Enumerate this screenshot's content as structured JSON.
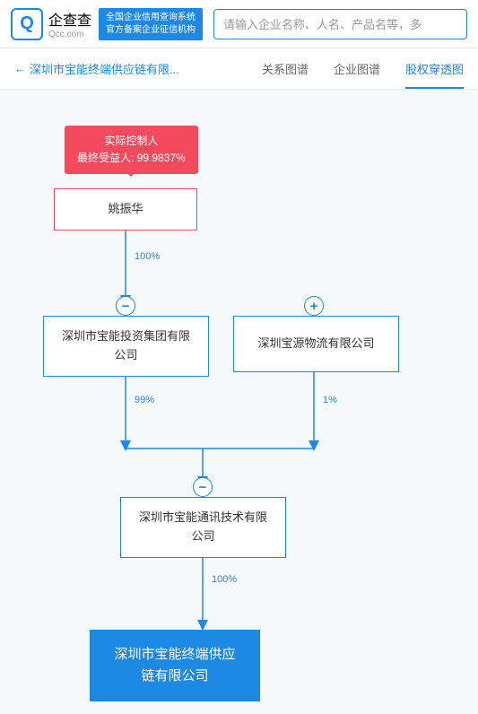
{
  "header": {
    "logo_title": "企查查",
    "logo_sub": "Qcc.com",
    "tagline_line1": "全国企业信用查询系统",
    "tagline_line2": "官方备案企业征信机构",
    "search_placeholder": "请输入企业名称、人名、产品名等，多"
  },
  "nav": {
    "back_label": "深圳市宝能终端供应链有限...",
    "tabs": [
      "关系图谱",
      "企业图谱",
      "股权穿透图"
    ],
    "active_tab": 2
  },
  "diagram": {
    "controller": {
      "line1": "实际控制人",
      "line2": "最终受益人: 99.9837%"
    },
    "nodes": {
      "person": "姚振华",
      "company1": "深圳市宝能投资集团有限公司",
      "company2": "深圳宝源物流有限公司",
      "company3": "深圳市宝能通讯技术有限公司",
      "final": "深圳市宝能终端供应链有限公司"
    },
    "percentages": {
      "p1": "100%",
      "p2": "99%",
      "p3": "1%",
      "p4": "100%"
    }
  }
}
